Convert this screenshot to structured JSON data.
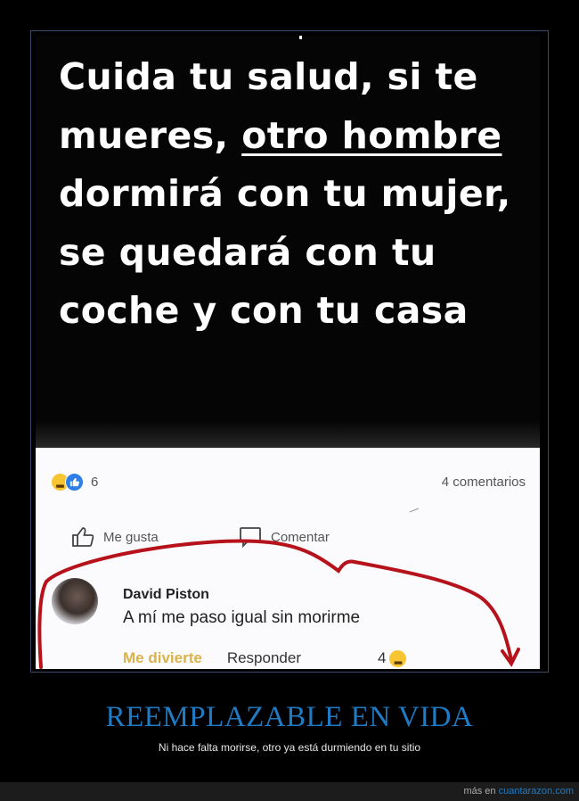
{
  "post": {
    "headline_part1": "Cuida tu salud, si te mueres, ",
    "headline_underlined": "otro hombre",
    "headline_part2": " dormirá con tu mujer, se quedará con tu coche y con tu casa"
  },
  "facebook": {
    "reactions": {
      "icons": [
        "haha-emoji-icon",
        "like-thumb-icon"
      ],
      "count": "6"
    },
    "comments_count": "4 comentarios",
    "actions": {
      "like_label": "Me gusta",
      "comment_label": "Comentar"
    },
    "comment": {
      "author": "David Piston",
      "text": "A mí me paso igual sin morirme",
      "funny_label": "Me divierte",
      "reply_label": "Responder",
      "reaction_count": "4"
    },
    "annotation_color": "#b5121b"
  },
  "caption": {
    "title": "REEMPLAZABLE EN VIDA",
    "subtitle": "Ni hace falta morirse, otro ya está durmiendo en tu sitio",
    "title_color": "#1f7bc4"
  },
  "footer": {
    "prefix": "más en ",
    "site": "cuantarazon.com"
  }
}
